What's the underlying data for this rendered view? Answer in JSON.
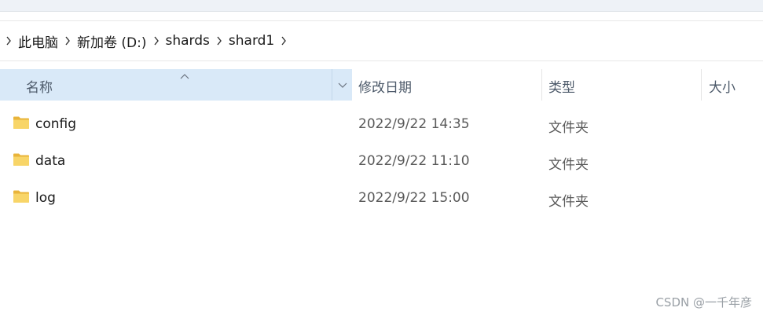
{
  "breadcrumb": {
    "items": [
      {
        "label": "此电脑"
      },
      {
        "label": "新加卷 (D:)"
      },
      {
        "label": "shards"
      },
      {
        "label": "shard1"
      }
    ]
  },
  "columns": {
    "name": "名称",
    "date": "修改日期",
    "type": "类型",
    "size": "大小"
  },
  "files": [
    {
      "name": "config",
      "date": "2022/9/22 14:35",
      "type": "文件夹",
      "icon": "folder-icon"
    },
    {
      "name": "data",
      "date": "2022/9/22 11:10",
      "type": "文件夹",
      "icon": "folder-icon"
    },
    {
      "name": "log",
      "date": "2022/9/22 15:00",
      "type": "文件夹",
      "icon": "folder-icon"
    }
  ],
  "watermark": "CSDN @一千年彦",
  "colors": {
    "header_selected_bg": "#d9e9f8",
    "folder_yellow": "#f6c94b"
  }
}
